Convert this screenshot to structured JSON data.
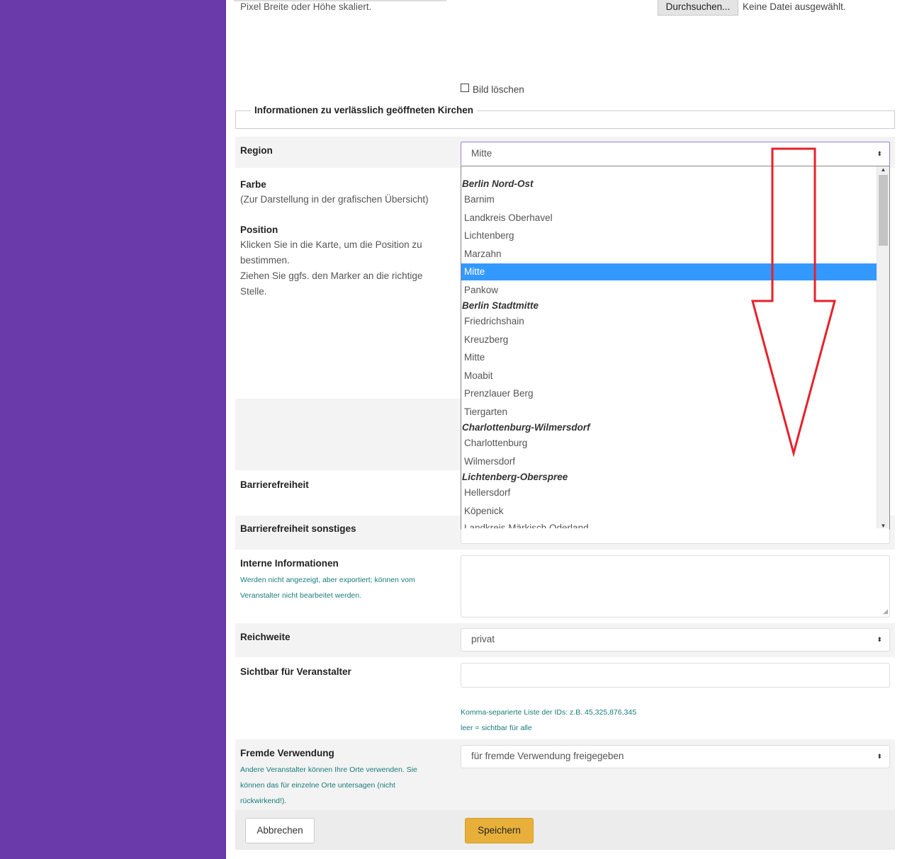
{
  "upload": {
    "note": "Pixel Breite oder Höhe skaliert.",
    "browse_label": "Durchsuchen...",
    "file_status": "Keine Datei ausgewählt."
  },
  "delete_image_label": "Bild löschen",
  "section_legend": "Informationen zu verlässlich geöffneten Kirchen",
  "region": {
    "label": "Region",
    "selected": "Mitte",
    "options": {
      "g1": "Berlin Nord-Ost",
      "o1": "Barnim",
      "o2": "Landkreis Oberhavel",
      "o3": "Lichtenberg",
      "o4": "Marzahn",
      "o5": "Mitte",
      "o6": "Pankow",
      "g2": "Berlin Stadtmitte",
      "o7": "Friedrichshain",
      "o8": "Kreuzberg",
      "o9": "Mitte",
      "o10": "Moabit",
      "o11": "Prenzlauer Berg",
      "o12": "Tiergarten",
      "g3": "Charlottenburg-Wilmersdorf",
      "o13": "Charlottenburg",
      "o14": "Wilmersdorf",
      "g4": "Lichtenberg-Oberspree",
      "o15": "Hellersdorf",
      "o16": "Köpenick",
      "o17": "Landkreis Märkisch Oderland"
    }
  },
  "farbe": {
    "label": "Farbe",
    "desc": "(Zur Darstellung in der grafischen Übersicht)"
  },
  "position": {
    "label": "Position",
    "desc1": "Klicken Sie in die Karte, um die Position zu",
    "desc2": "bestimmen.",
    "desc3": "Ziehen Sie ggfs. den Marker an die richtige",
    "desc4": "Stelle."
  },
  "barrierefreiheit_label": "Barrierefreiheit",
  "barrierefreiheit_sonstiges_label": "Barrierefreiheit sonstiges",
  "interne": {
    "label": "Interne Informationen",
    "hint1": "Werden nicht angezeigt, aber exportiert; können vom",
    "hint2": "Veranstalter nicht bearbeitet werden."
  },
  "reichweite": {
    "label": "Reichweite",
    "selected": "privat"
  },
  "sichtbar": {
    "label": "Sichtbar für Veranstalter",
    "hint1": "Komma-separierte Liste der IDs: z.B. 45,325,876,345",
    "hint2": "leer = sichtbar für alle"
  },
  "fremde": {
    "label": "Fremde Verwendung",
    "selected": "für fremde Verwendung freigegeben",
    "hint1": "Andere Veranstalter können Ihre Orte verwenden. Sie",
    "hint2": "können das für einzelne Orte untersagen (nicht",
    "hint3": "rückwirkend!)."
  },
  "buttons": {
    "cancel": "Abbrechen",
    "save": "Speichern"
  },
  "colors": {
    "sidebar": "#6a3aab",
    "selected_option": "#3399ff",
    "save_button": "#e8b03a",
    "annotation_arrow": "#e8202a"
  }
}
